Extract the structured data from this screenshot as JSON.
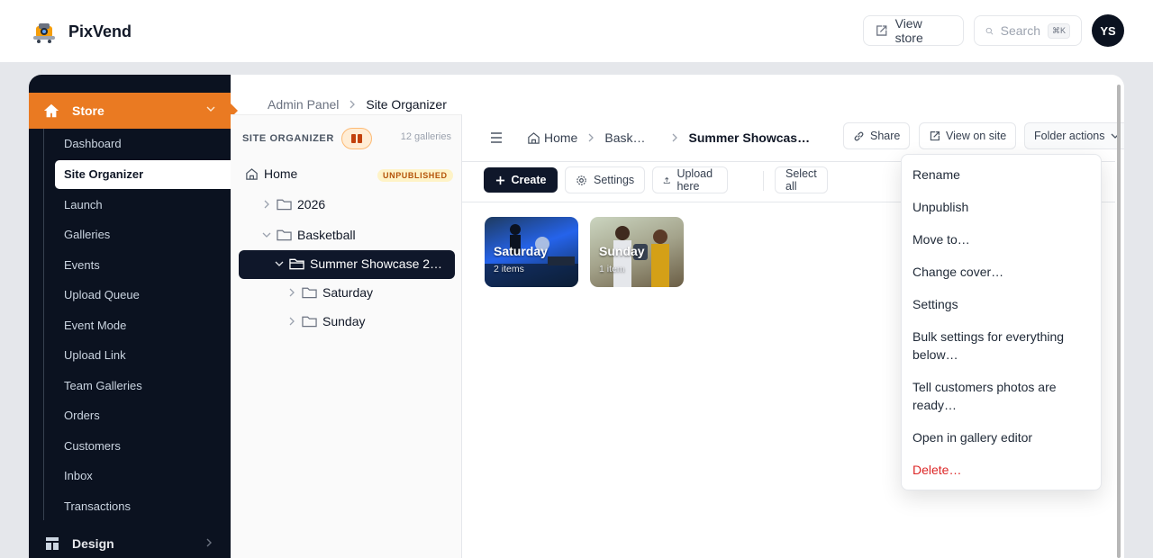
{
  "app": {
    "name": "PixVend"
  },
  "header": {
    "view_store": "View store",
    "search_placeholder": "Search",
    "search_shortcut": "⌘K",
    "avatar_initials": "YS"
  },
  "sidebar": {
    "section": "Store",
    "items": [
      {
        "label": "Dashboard"
      },
      {
        "label": "Site Organizer",
        "active": true
      },
      {
        "label": "Launch"
      },
      {
        "label": "Galleries"
      },
      {
        "label": "Events"
      },
      {
        "label": "Upload Queue"
      },
      {
        "label": "Event Mode"
      },
      {
        "label": "Upload Link"
      },
      {
        "label": "Team Galleries"
      },
      {
        "label": "Orders"
      },
      {
        "label": "Customers"
      },
      {
        "label": "Inbox"
      },
      {
        "label": "Transactions"
      }
    ],
    "next_section": "Design"
  },
  "breadcrumb": {
    "parent": "Admin Panel",
    "current": "Site Organizer"
  },
  "organizer": {
    "title": "SITE ORGANIZER",
    "count": "12 galleries",
    "tree": {
      "home": "Home",
      "home_badge": "UNPUBLISHED",
      "year": "2026",
      "basketball": "Basketball",
      "selected": "Summer Showcase 2…",
      "saturday": "Saturday",
      "sunday": "Sunday"
    }
  },
  "content": {
    "crumbs": {
      "home": "Home",
      "mid": "Bask…",
      "current": "Summer Showcas…"
    },
    "share": "Share",
    "view_on_site": "View on site",
    "folder_actions": "Folder actions",
    "create": "Create",
    "settings": "Settings",
    "upload_here": "Upload here",
    "select_all": "Select all",
    "tiles": [
      {
        "name": "Saturday",
        "count": "2 items"
      },
      {
        "name": "Sunday",
        "count": "1 item"
      }
    ]
  },
  "folder_menu": {
    "items": [
      "Rename",
      "Unpublish",
      "Move to…",
      "Change cover…",
      "Settings",
      "Bulk settings for everything below…",
      "Tell customers photos are ready…",
      "Open in gallery editor",
      "Delete…"
    ]
  },
  "colors": {
    "accent": "#ea7a22",
    "sidebar_bg": "#0b1220",
    "danger": "#dc2626"
  }
}
